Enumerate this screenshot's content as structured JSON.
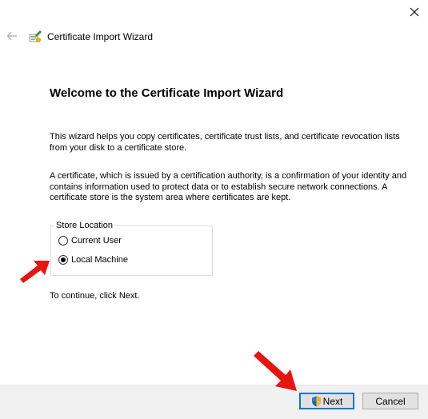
{
  "window": {
    "close_icon": "close-icon",
    "back_icon": "back-arrow-icon",
    "wizard_icon": "certificate-icon",
    "title": "Certificate Import Wizard"
  },
  "main": {
    "heading": "Welcome to the Certificate Import Wizard",
    "paragraph1": "This wizard helps you copy certificates, certificate trust lists, and certificate revocation lists from your disk to a certificate store.",
    "paragraph2": "A certificate, which is issued by a certification authority, is a confirmation of your identity and contains information used to protect data or to establish secure network connections. A certificate store is the system area where certificates are kept.",
    "store_location": {
      "label": "Store Location",
      "options": [
        {
          "label": "Current User",
          "selected": false
        },
        {
          "label": "Local Machine",
          "selected": true
        }
      ]
    },
    "continue_text": "To continue, click Next."
  },
  "footer": {
    "next_label": "Next",
    "next_icon": "uac-shield-icon",
    "cancel_label": "Cancel"
  },
  "annotations": {
    "arrow_color": "#e8140f",
    "arrow_icon": "red-arrow-icon"
  },
  "colors": {
    "accent": "#0078d7",
    "footer_bg": "#f0f0f0"
  }
}
